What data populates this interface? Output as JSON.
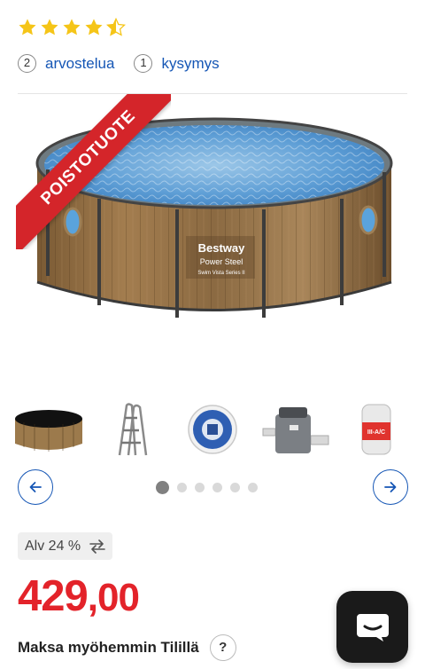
{
  "rating": {
    "value": 4.5,
    "max": 5
  },
  "counts": {
    "reviews": {
      "count": "2",
      "label": "arvostelua"
    },
    "questions": {
      "count": "1",
      "label": "kysymys"
    }
  },
  "product_image": {
    "ribbon": "POISTOTUOTE",
    "brand": "Bestway",
    "line": "Power Steel",
    "series": "Swim Vista Series II"
  },
  "thumbnails": [
    {
      "name": "pool-thumbnail"
    },
    {
      "name": "ladder-thumbnail"
    },
    {
      "name": "skimmer-thumbnail"
    },
    {
      "name": "filter-pump-thumbnail"
    },
    {
      "name": "filter-cartridge-thumbnail",
      "label": "III-A/C"
    }
  ],
  "carousel": {
    "slide_count": 6,
    "active_index": 0
  },
  "vat": {
    "label": "Alv 24 %"
  },
  "price": {
    "whole": "429",
    "cents": ",00"
  },
  "paylater": {
    "label": "Maksa myöhemmin Tilillä",
    "help": "?"
  },
  "colors": {
    "price": "#e3232a",
    "link": "#1556b5",
    "ribbon": "#d4252a",
    "star": "#f5c518"
  }
}
